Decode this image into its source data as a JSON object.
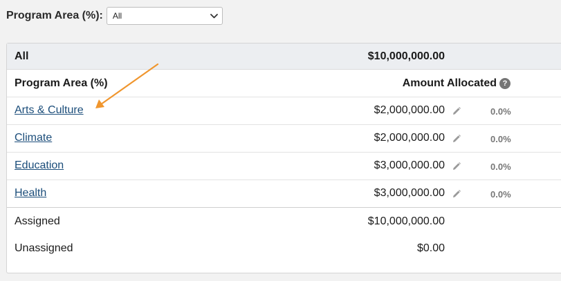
{
  "filter": {
    "label": "Program Area (%):",
    "selected": "All"
  },
  "total": {
    "label": "All",
    "amount": "$10,000,000.00"
  },
  "table_header": {
    "program_area": "Program Area (%)",
    "amount_allocated": "Amount Allocated",
    "help_symbol": "?"
  },
  "rows": [
    {
      "name": "Arts & Culture",
      "amount": "$2,000,000.00",
      "percent": "0.0%"
    },
    {
      "name": "Climate",
      "amount": "$2,000,000.00",
      "percent": "0.0%"
    },
    {
      "name": "Education",
      "amount": "$3,000,000.00",
      "percent": "0.0%"
    },
    {
      "name": "Health",
      "amount": "$3,000,000.00",
      "percent": "0.0%"
    }
  ],
  "summary": {
    "assigned_label": "Assigned",
    "assigned_amount": "$10,000,000.00",
    "unassigned_label": "Unassigned",
    "unassigned_amount": "$0.00"
  },
  "colors": {
    "link": "#1b4d7a",
    "annotation_arrow": "#f0962e",
    "total_row_bg": "#eceef1"
  },
  "icons": {
    "edit": "pencil-icon",
    "help": "question-circle-icon",
    "dropdown": "chevron-down-icon"
  }
}
